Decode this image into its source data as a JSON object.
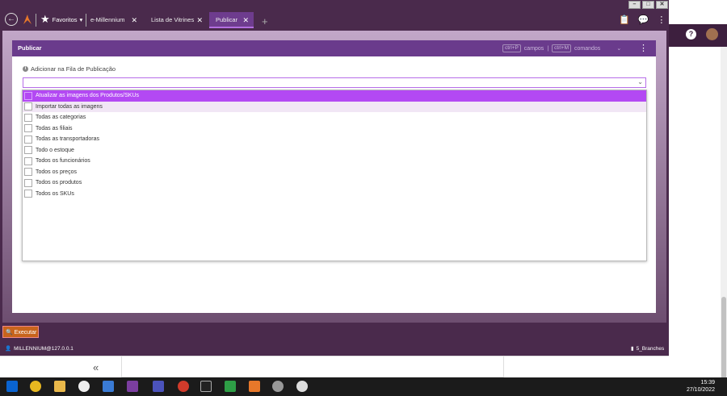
{
  "tabs": [
    {
      "label": "Favoritos"
    },
    {
      "label": "e-Millennium"
    },
    {
      "label": "Lista de Vitrines"
    },
    {
      "label": "Publicar"
    }
  ],
  "favorites_chevron": "▾",
  "card": {
    "title": "Publicar",
    "hint_campos_key": "ctrl+P",
    "hint_campos_label": "campos",
    "hint_sep": "|",
    "hint_comandos_key": "ctrl+M",
    "hint_comandos_label": "comandos"
  },
  "field": {
    "label": "Adicionar na Fila de Publicação",
    "value": ""
  },
  "options": [
    {
      "label": "Atualizar as imagens dos Produtos/SKUs"
    },
    {
      "label": "Importar todas as imagens"
    },
    {
      "label": "Todas as categorias"
    },
    {
      "label": "Todas as filiais"
    },
    {
      "label": "Todas as transportadoras"
    },
    {
      "label": "Todo o estoque"
    },
    {
      "label": "Todos os funcionários"
    },
    {
      "label": "Todos os preços"
    },
    {
      "label": "Todos os produtos"
    },
    {
      "label": "Todos os SKUs"
    }
  ],
  "execute_label": "Executar",
  "status": {
    "user": "MILLENNIUM@127.0.0.1",
    "branch": "5_Branches"
  },
  "clock": {
    "time": "15:39",
    "date": "27/10/2022"
  },
  "colors": {
    "accent": "#b349f3",
    "header": "#6a3b8c",
    "app_bg": "#4a2a4c",
    "execute": "#c8641c"
  }
}
